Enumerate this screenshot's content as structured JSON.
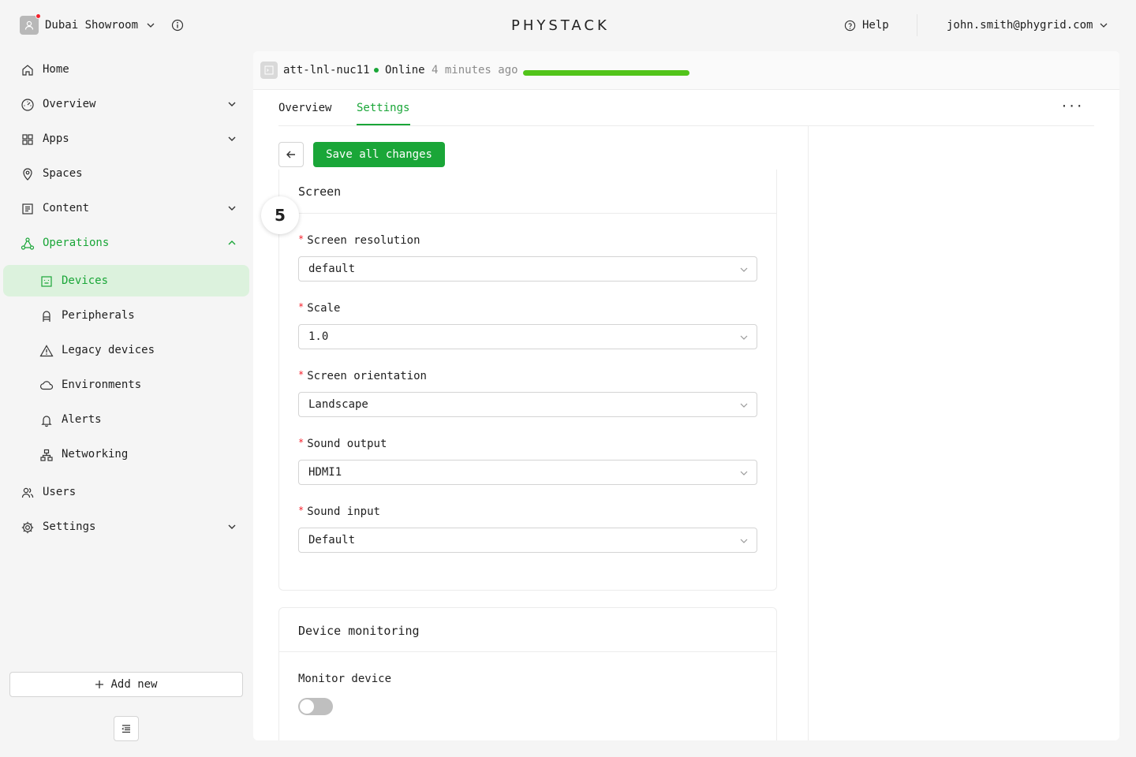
{
  "header": {
    "org_name": "Dubai Showroom",
    "logo": "PHYSTACK",
    "help_label": "Help",
    "user_email": "john.smith@phygrid.com"
  },
  "sidebar": {
    "items": [
      {
        "label": "Home",
        "icon": "home-icon"
      },
      {
        "label": "Overview",
        "icon": "dashboard-icon"
      },
      {
        "label": "Apps",
        "icon": "apps-grid-icon"
      },
      {
        "label": "Spaces",
        "icon": "location-pin-icon"
      },
      {
        "label": "Content",
        "icon": "content-list-icon"
      },
      {
        "label": "Operations",
        "icon": "operations-nodes-icon"
      },
      {
        "label": "Devices",
        "icon": "device-screen-icon"
      },
      {
        "label": "Peripherals",
        "icon": "peripheral-icon"
      },
      {
        "label": "Legacy devices",
        "icon": "warning-triangle-icon"
      },
      {
        "label": "Environments",
        "icon": "cloud-icon"
      },
      {
        "label": "Alerts",
        "icon": "bell-icon"
      },
      {
        "label": "Networking",
        "icon": "network-icon"
      },
      {
        "label": "Users",
        "icon": "users-icon"
      },
      {
        "label": "Settings",
        "icon": "gear-icon"
      }
    ],
    "add_new_label": "Add new"
  },
  "device": {
    "name": "att-lnl-nuc11",
    "status": "Online",
    "last_seen": "4 minutes ago",
    "status_color": "#1aa638"
  },
  "tabs": [
    {
      "label": "Overview"
    },
    {
      "label": "Settings"
    }
  ],
  "more_label": "···",
  "save_label": "Save all changes",
  "screen_section": {
    "title": "Screen",
    "fields": [
      {
        "label": "Screen resolution",
        "value": "default"
      },
      {
        "label": "Scale",
        "value": "1.0"
      },
      {
        "label": "Screen orientation",
        "value": "Landscape"
      },
      {
        "label": "Sound output",
        "value": "HDMI1"
      },
      {
        "label": "Sound input",
        "value": "Default"
      }
    ]
  },
  "monitor_section": {
    "title": "Device monitoring",
    "monitor_label": "Monitor device",
    "monitor_enabled": false
  },
  "step_badge": "5",
  "colors": {
    "accent": "#1aa638",
    "selected_bg": "#dcf2dd"
  }
}
